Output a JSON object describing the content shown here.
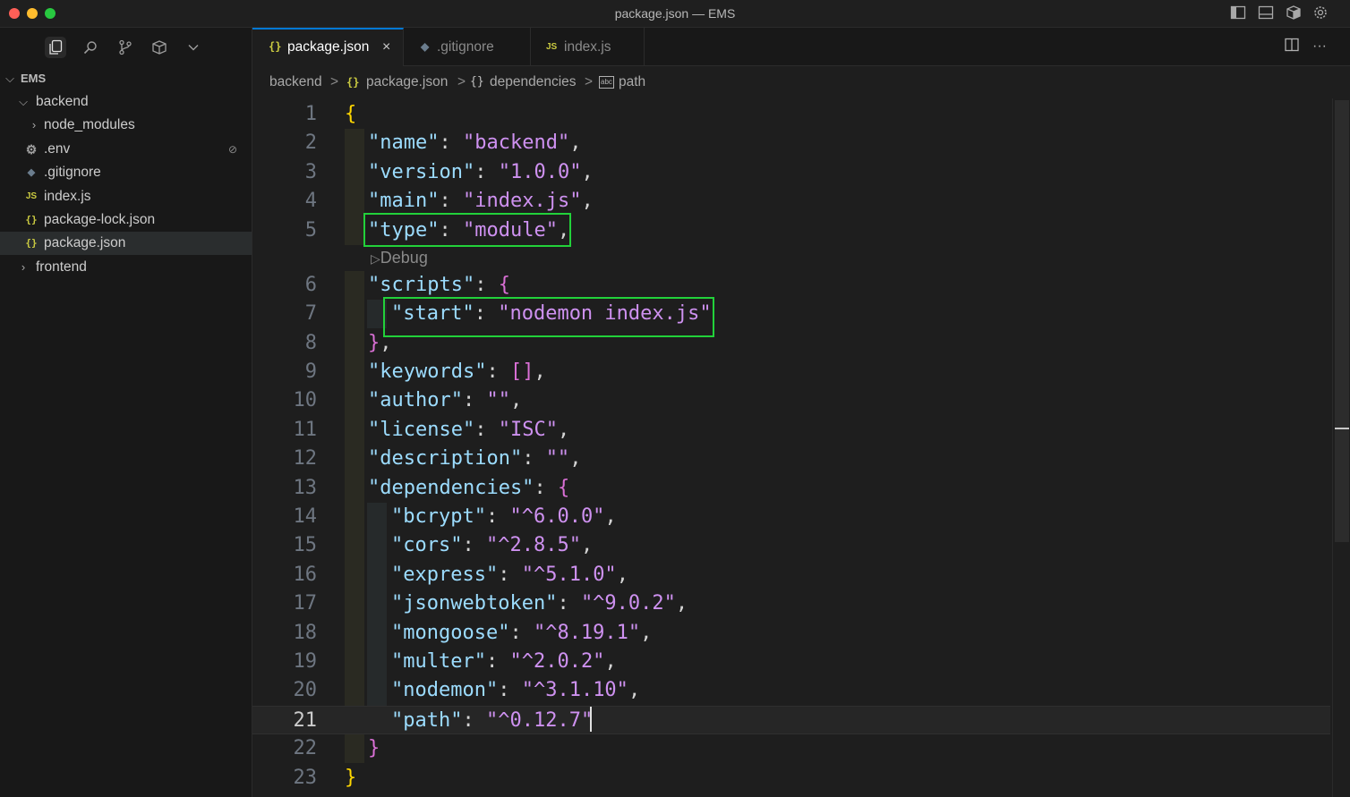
{
  "window": {
    "title": "package.json — EMS"
  },
  "titlebar_icons": [
    "toggle-sidebar-icon",
    "toggle-panel-icon",
    "extension-box-icon",
    "settings-gear-icon"
  ],
  "activity": {
    "icons": [
      "explorer-icon",
      "search-icon",
      "source-control-icon",
      "extensions-icon",
      "chevron-down-icon"
    ]
  },
  "explorer": {
    "root": "EMS",
    "items": [
      {
        "label": "backend",
        "type": "folder",
        "expanded": true
      },
      {
        "label": "node_modules",
        "type": "folder",
        "expanded": false
      },
      {
        "label": ".env",
        "type": "env"
      },
      {
        "label": ".gitignore",
        "type": "git"
      },
      {
        "label": "index.js",
        "type": "js"
      },
      {
        "label": "package-lock.json",
        "type": "json"
      },
      {
        "label": "package.json",
        "type": "json",
        "selected": true
      },
      {
        "label": "frontend",
        "type": "folder",
        "expanded": false
      }
    ],
    "icon_glyphs": {
      "json": "{}",
      "js": "JS",
      "chevron_open": "⌵",
      "chevron_closed": "›"
    }
  },
  "tabs": [
    {
      "label": "package.json",
      "icon": "{}",
      "active": true,
      "close": "×"
    },
    {
      "label": ".gitignore",
      "icon": "◆",
      "active": false
    },
    {
      "label": "index.js",
      "icon": "JS",
      "active": false
    }
  ],
  "editor_actions": [
    "split-editor-icon",
    "more-actions-icon"
  ],
  "breadcrumb": {
    "parts": [
      "backend",
      "package.json",
      "dependencies",
      "path"
    ],
    "icons": [
      "{}",
      "{}",
      "abc"
    ],
    "separator": ">"
  },
  "editor": {
    "codelens": "Debug",
    "current_line": 21,
    "lines": [
      {
        "n": "1",
        "tokens": [
          [
            "b1",
            "{"
          ]
        ]
      },
      {
        "n": "2",
        "tokens": [
          [
            "k",
            "\"name\""
          ],
          [
            "p",
            ": "
          ],
          [
            "s",
            "\"backend\""
          ],
          [
            "p",
            ","
          ]
        ]
      },
      {
        "n": "3",
        "tokens": [
          [
            "k",
            "\"version\""
          ],
          [
            "p",
            ": "
          ],
          [
            "s",
            "\"1.0.0\""
          ],
          [
            "p",
            ","
          ]
        ]
      },
      {
        "n": "4",
        "tokens": [
          [
            "k",
            "\"main\""
          ],
          [
            "p",
            ": "
          ],
          [
            "s",
            "\"index.js\""
          ],
          [
            "p",
            ","
          ]
        ]
      },
      {
        "n": "5",
        "tokens": [
          [
            "k",
            "\"type\""
          ],
          [
            "p",
            ": "
          ],
          [
            "s",
            "\"module\""
          ],
          [
            "p",
            ","
          ]
        ]
      },
      {
        "n": "6",
        "tokens": [
          [
            "k",
            "\"scripts\""
          ],
          [
            "p",
            ": "
          ],
          [
            "b2",
            "{"
          ]
        ]
      },
      {
        "n": "7",
        "tokens": [
          [
            "k",
            "\"start\""
          ],
          [
            "p",
            ": "
          ],
          [
            "s",
            "\"nodemon index.js\""
          ]
        ]
      },
      {
        "n": "8",
        "tokens": [
          [
            "b2",
            "}"
          ],
          [
            "p",
            ","
          ]
        ]
      },
      {
        "n": "9",
        "tokens": [
          [
            "k",
            "\"keywords\""
          ],
          [
            "p",
            ": "
          ],
          [
            "b2",
            "[]"
          ],
          [
            "p",
            ","
          ]
        ]
      },
      {
        "n": "10",
        "tokens": [
          [
            "k",
            "\"author\""
          ],
          [
            "p",
            ": "
          ],
          [
            "s",
            "\"\""
          ],
          [
            "p",
            ","
          ]
        ]
      },
      {
        "n": "11",
        "tokens": [
          [
            "k",
            "\"license\""
          ],
          [
            "p",
            ": "
          ],
          [
            "s",
            "\"ISC\""
          ],
          [
            "p",
            ","
          ]
        ]
      },
      {
        "n": "12",
        "tokens": [
          [
            "k",
            "\"description\""
          ],
          [
            "p",
            ": "
          ],
          [
            "s",
            "\"\""
          ],
          [
            "p",
            ","
          ]
        ]
      },
      {
        "n": "13",
        "tokens": [
          [
            "k",
            "\"dependencies\""
          ],
          [
            "p",
            ": "
          ],
          [
            "b2",
            "{"
          ]
        ]
      },
      {
        "n": "14",
        "tokens": [
          [
            "k",
            "\"bcrypt\""
          ],
          [
            "p",
            ": "
          ],
          [
            "s",
            "\"^6.0.0\""
          ],
          [
            "p",
            ","
          ]
        ]
      },
      {
        "n": "15",
        "tokens": [
          [
            "k",
            "\"cors\""
          ],
          [
            "p",
            ": "
          ],
          [
            "s",
            "\"^2.8.5\""
          ],
          [
            "p",
            ","
          ]
        ]
      },
      {
        "n": "16",
        "tokens": [
          [
            "k",
            "\"express\""
          ],
          [
            "p",
            ": "
          ],
          [
            "s",
            "\"^5.1.0\""
          ],
          [
            "p",
            ","
          ]
        ]
      },
      {
        "n": "17",
        "tokens": [
          [
            "k",
            "\"jsonwebtoken\""
          ],
          [
            "p",
            ": "
          ],
          [
            "s",
            "\"^9.0.2\""
          ],
          [
            "p",
            ","
          ]
        ]
      },
      {
        "n": "18",
        "tokens": [
          [
            "k",
            "\"mongoose\""
          ],
          [
            "p",
            ": "
          ],
          [
            "s",
            "\"^8.19.1\""
          ],
          [
            "p",
            ","
          ]
        ]
      },
      {
        "n": "19",
        "tokens": [
          [
            "k",
            "\"multer\""
          ],
          [
            "p",
            ": "
          ],
          [
            "s",
            "\"^2.0.2\""
          ],
          [
            "p",
            ","
          ]
        ]
      },
      {
        "n": "20",
        "tokens": [
          [
            "k",
            "\"nodemon\""
          ],
          [
            "p",
            ": "
          ],
          [
            "s",
            "\"^3.1.10\""
          ],
          [
            "p",
            ","
          ]
        ]
      },
      {
        "n": "21",
        "tokens": [
          [
            "k",
            "\"path\""
          ],
          [
            "p",
            ": "
          ],
          [
            "s",
            "\"^0.12.7\""
          ]
        ]
      },
      {
        "n": "22",
        "tokens": [
          [
            "b2",
            "}"
          ]
        ]
      },
      {
        "n": "23",
        "tokens": [
          [
            "b1",
            "}"
          ]
        ]
      }
    ]
  },
  "colors": {
    "accent": "#0078d4",
    "highlight_box": "#22d13a",
    "string": "#ce91f0",
    "key": "#9cdcfe",
    "bracket_outer": "#ffd700",
    "bracket_inner": "#da70d6"
  }
}
